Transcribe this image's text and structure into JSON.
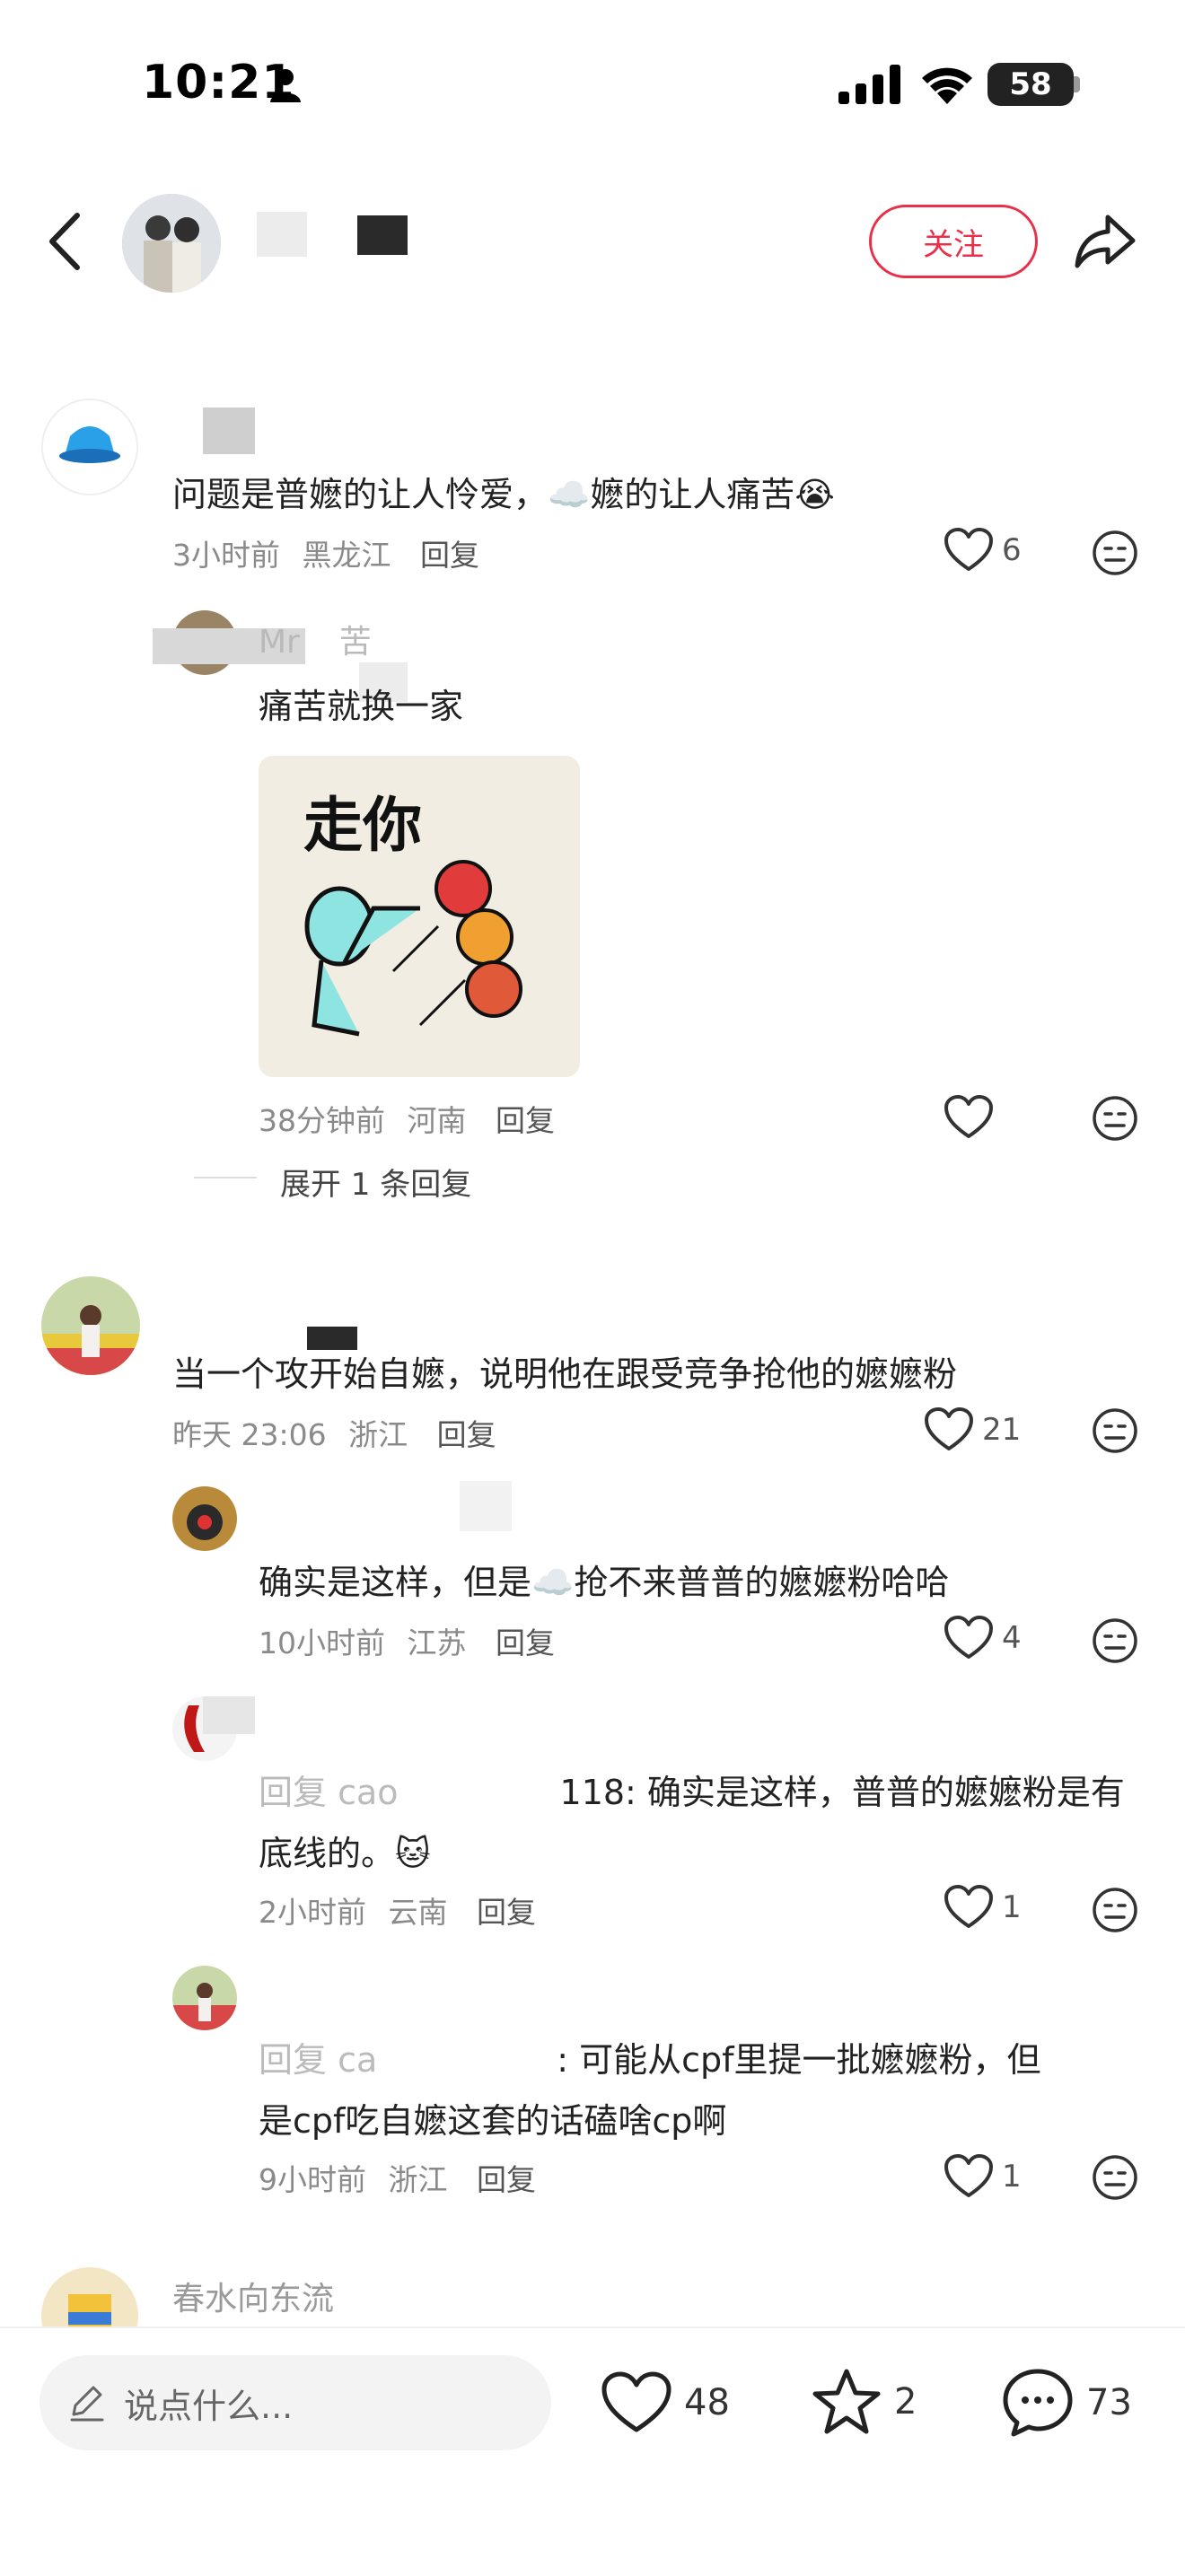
{
  "status_bar": {
    "time": "10:21",
    "battery": "58"
  },
  "header": {
    "follow_label": "关注"
  },
  "comments": [
    {
      "text": "问题是普嬷的让人怜爱，☁️嬷的让人痛苦😭",
      "time": "3小时前",
      "location": "黑龙江",
      "reply": "回复",
      "likes": "6",
      "replies": [
        {
          "name_partial": "Mr",
          "name_partial2": "苦",
          "text": "痛苦就换一家",
          "sticker_text": "走你",
          "time": "38分钟前",
          "location": "河南",
          "reply": "回复",
          "likes": "",
          "expand_label": "展开 1 条回复"
        }
      ]
    },
    {
      "text": "当一个攻开始自嬷，说明他在跟受竞争抢他的嬷嬷粉",
      "time": "昨天 23:06",
      "location": "浙江",
      "reply": "回复",
      "likes": "21",
      "replies": [
        {
          "text": "确实是这样，但是☁️抢不来普普的嬷嬷粉哈哈",
          "time": "10小时前",
          "location": "江苏",
          "reply": "回复",
          "likes": "4"
        },
        {
          "prefix": "回复 cao",
          "suffix": "118: 确实是这样，普普的嬷嬷粉是有",
          "line2": "底线的。🐱",
          "time": "2小时前",
          "location": "云南",
          "reply": "回复",
          "likes": "1"
        },
        {
          "prefix": "回复 ca",
          "suffix": ": 可能从cpf里提一批嬷嬷粉，但",
          "line2": "是cpf吃自嬷这套的话磕啥cp啊",
          "time": "9小时前",
          "location": "浙江",
          "reply": "回复",
          "likes": "1"
        }
      ]
    },
    {
      "name": "春水向东流"
    }
  ],
  "bottom_bar": {
    "input_placeholder": "说点什么...",
    "likes": "48",
    "stars": "2",
    "comments": "73"
  },
  "colors": {
    "accent": "#e8304a",
    "meta": "#8a8a8a"
  },
  "icons": [
    "person-icon",
    "signal-icon",
    "wifi-icon",
    "back-icon",
    "share-icon",
    "heart-icon",
    "emoji-face-icon",
    "pencil-icon",
    "star-icon",
    "chat-bubble-icon"
  ]
}
